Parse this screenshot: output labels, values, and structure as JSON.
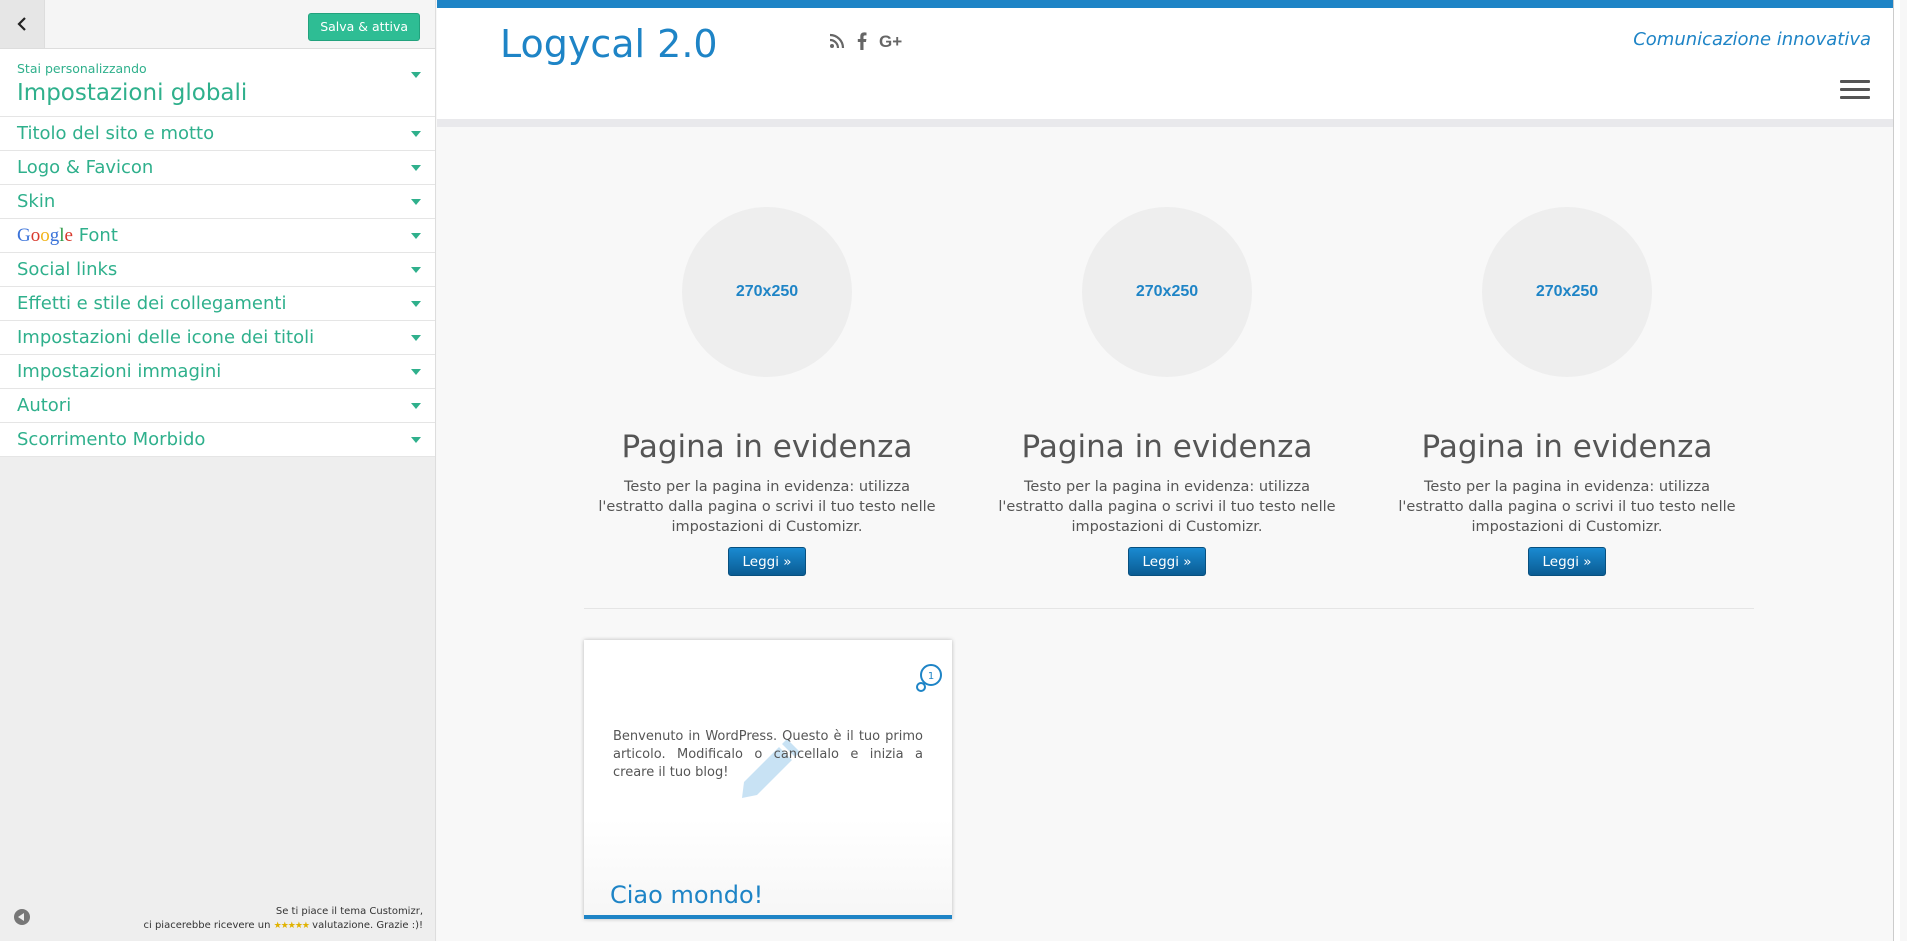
{
  "customizer": {
    "save_label": "Salva & attiva",
    "customizing_label": "Stai personalizzando",
    "section_title": "Impostazioni globali",
    "items": [
      {
        "label": "Titolo del sito e motto"
      },
      {
        "label": "Logo & Favicon"
      },
      {
        "label": "Skin"
      },
      {
        "label": "Font",
        "prefix": "Google"
      },
      {
        "label": "Social links"
      },
      {
        "label": "Effetti e stile dei collegamenti"
      },
      {
        "label": "Impostazioni delle icone dei titoli"
      },
      {
        "label": "Impostazioni immagini"
      },
      {
        "label": "Autori"
      },
      {
        "label": "Scorrimento Morbido"
      }
    ],
    "footer_line1": "Se ti piace il tema Customizr,",
    "footer_line2_pre": "ci piacerebbe ricevere un",
    "footer_stars": "★★★★★",
    "footer_line2_post": "valutazione. Grazie :)!"
  },
  "site": {
    "title": "Logycal 2.0",
    "tagline": "Comunicazione innovativa",
    "social_icons": [
      "rss-icon",
      "facebook-icon",
      "google-plus-icon"
    ],
    "accent_color": "#1e84c6"
  },
  "featured": [
    {
      "thumb": "270x250",
      "title": "Pagina in evidenza",
      "text": "Testo per la pagina in evidenza: utilizza l'estratto dalla pagina o scrivi il tuo testo nelle impostazioni di Customizr.",
      "button": "Leggi »"
    },
    {
      "thumb": "270x250",
      "title": "Pagina in evidenza",
      "text": "Testo per la pagina in evidenza: utilizza l'estratto dalla pagina o scrivi il tuo testo nelle impostazioni di Customizr.",
      "button": "Leggi »"
    },
    {
      "thumb": "270x250",
      "title": "Pagina in evidenza",
      "text": "Testo per la pagina in evidenza: utilizza l'estratto dalla pagina o scrivi il tuo testo nelle impostazioni di Customizr.",
      "button": "Leggi »"
    }
  ],
  "post": {
    "comment_count": "1",
    "excerpt": "Benvenuto in WordPress. Questo è il tuo primo articolo. Modificalo o cancellalo e inizia a creare il tuo blog!",
    "title": "Ciao mondo!"
  }
}
